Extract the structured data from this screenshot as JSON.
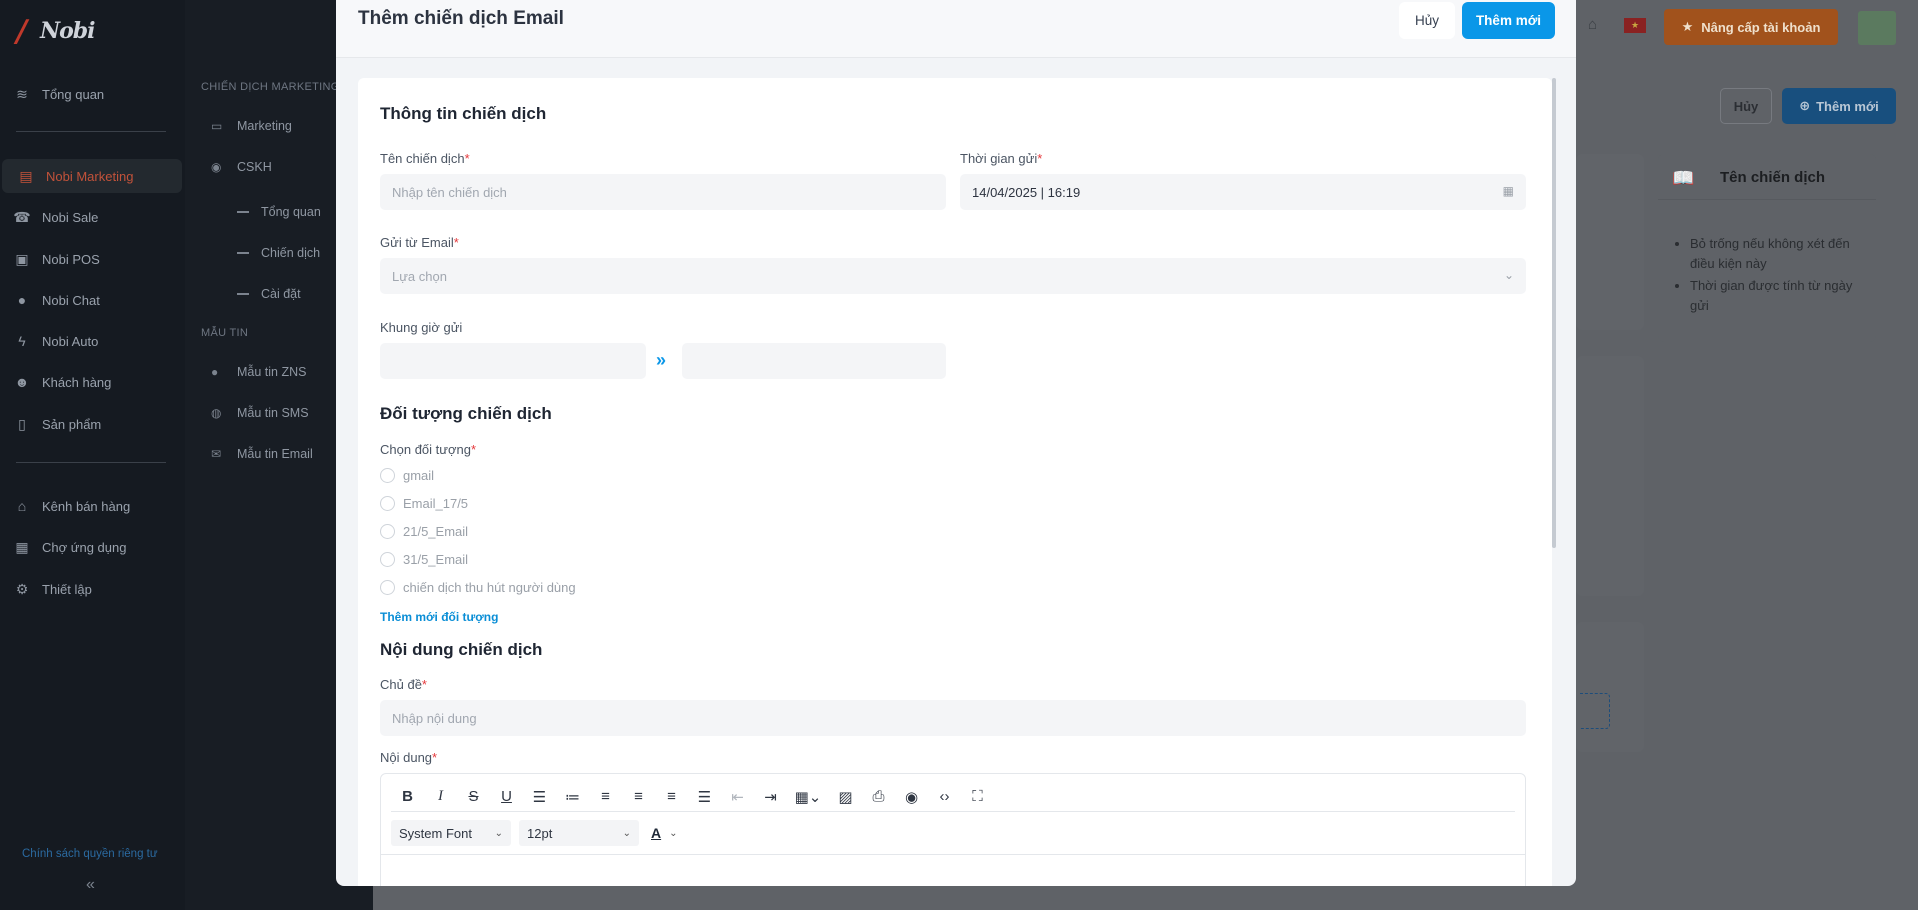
{
  "app": {
    "logo_text": "Nobi"
  },
  "sidebar": {
    "items": [
      {
        "label": "Tổng quan",
        "icon": "layers-icon"
      },
      {
        "label": "Nobi Marketing",
        "icon": "megaphone-icon"
      },
      {
        "label": "Nobi Sale",
        "icon": "phone-icon"
      },
      {
        "label": "Nobi POS",
        "icon": "cash-icon"
      },
      {
        "label": "Nobi Chat",
        "icon": "chat-icon"
      },
      {
        "label": "Nobi Auto",
        "icon": "bolt-icon"
      },
      {
        "label": "Khách hàng",
        "icon": "users-icon"
      },
      {
        "label": "Sản phẩm",
        "icon": "file-icon"
      },
      {
        "label": "Kênh bán hàng",
        "icon": "store-icon"
      },
      {
        "label": "Chợ ứng dụng",
        "icon": "apps-icon"
      },
      {
        "label": "Thiết lập",
        "icon": "gear-icon"
      }
    ],
    "privacy": "Chính sách quyền riêng tư",
    "collapse": "«"
  },
  "subnav": {
    "marketing_head": "CHIẾN DỊCH MARKETING",
    "marketing": "Marketing",
    "cskh": "CSKH",
    "cskh_children": [
      "Tổng quan",
      "Chiến dịch",
      "Cài đặt"
    ],
    "templates_head": "MẪU TIN",
    "templates": [
      "Mẫu tin ZNS",
      "Mẫu tin SMS",
      "Mẫu tin Email"
    ]
  },
  "topbar": {
    "upgrade": "Nâng cấp tài khoản",
    "flag": "★"
  },
  "page": {
    "cancel": "Hủy",
    "add": "Thêm mới",
    "help_title": "Tên chiến dịch",
    "help_items": [
      "Bỏ trống nếu không xét đến điều kiện này",
      "Thời gian được tính từ ngày gửi"
    ]
  },
  "modal": {
    "title": "Thêm chiến dịch Email",
    "cancel": "Hủy",
    "add": "Thêm mới",
    "section_info": "Thông tin chiến dịch",
    "name_label": "Tên chiến dịch",
    "name_placeholder": "Nhập tên chiến dịch",
    "time_label": "Thời gian gửi",
    "time_value": "14/04/2025 | 16:19",
    "from_label": "Gửi từ Email",
    "from_placeholder": "Lựa chọn",
    "window_label": "Khung giờ gửi",
    "window_arrow": "»",
    "section_audience": "Đối tượng chiến dịch",
    "audience_label": "Chọn đối tượng",
    "audiences": [
      "gmail",
      "Email_17/5",
      "21/5_Email",
      "31/5_Email",
      "chiến dịch thu hút người dùng"
    ],
    "add_audience": "Thêm mới đối tượng",
    "section_content": "Nội dung chiến dịch",
    "subject_label": "Chủ đề",
    "subject_placeholder": "Nhập nội dung",
    "content_label": "Nội dung",
    "required_mark": "*",
    "editor": {
      "font": "System Font",
      "size": "12pt",
      "color_letter": "A"
    }
  }
}
